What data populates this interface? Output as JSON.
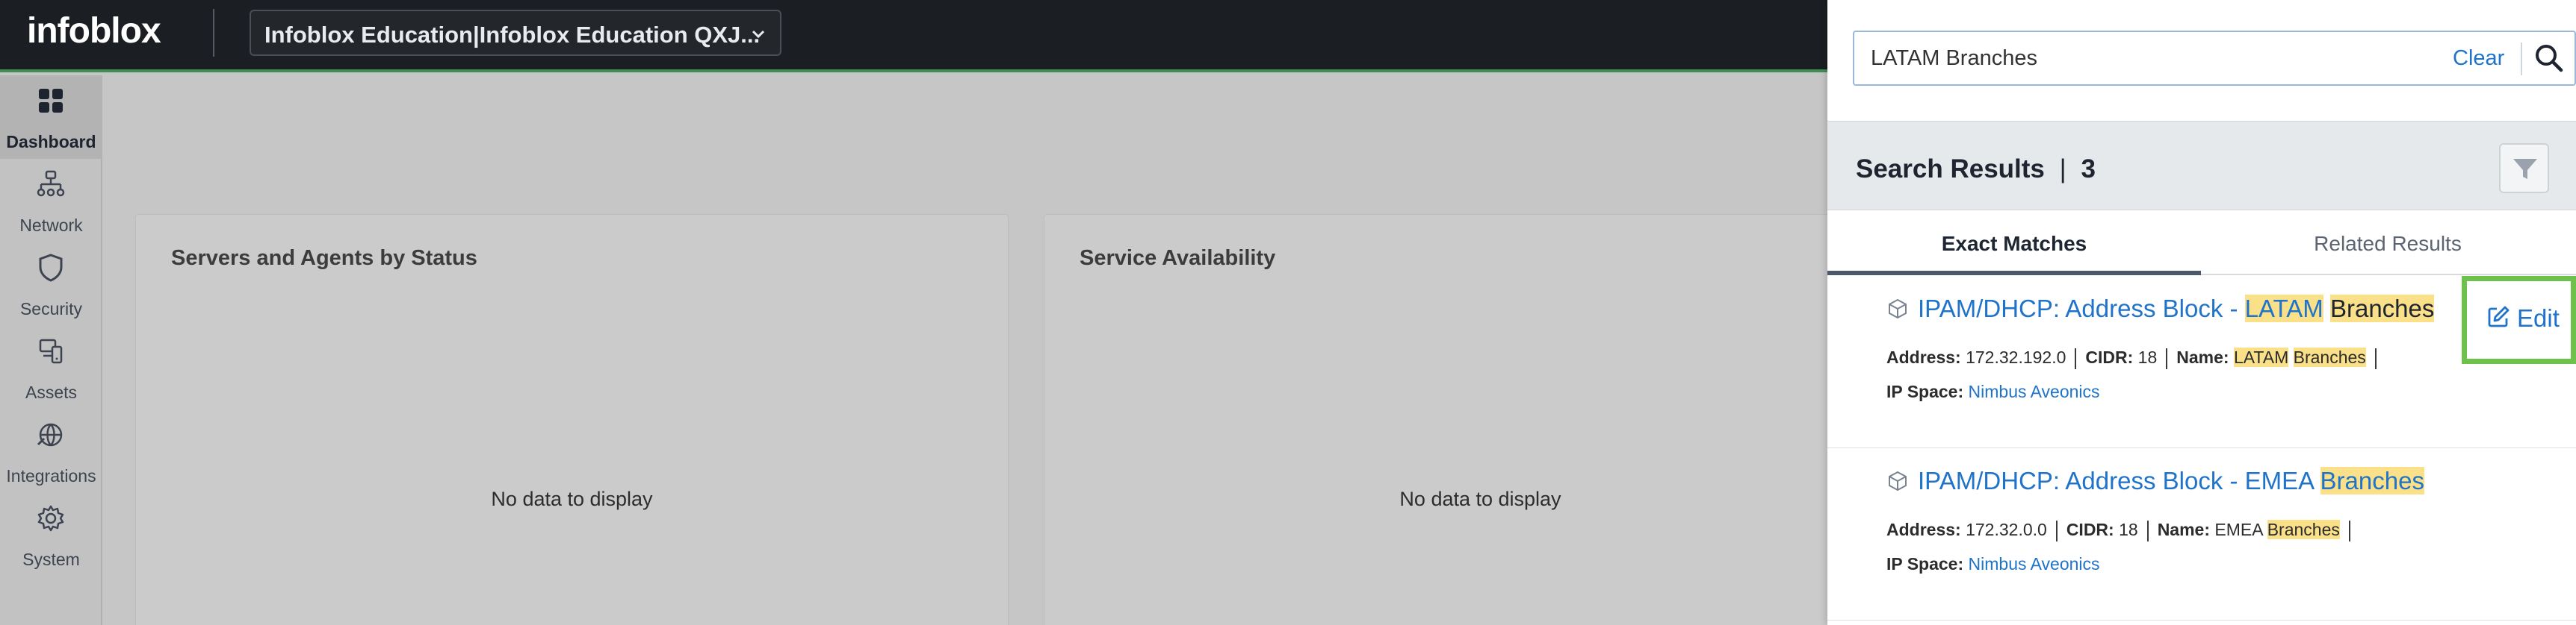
{
  "topbar": {
    "logo_text": "infoblox",
    "tenant_label": "Infoblox Education|Infoblox Education QXJ..."
  },
  "sidenav": {
    "items": [
      {
        "label": "Dashboard",
        "icon": "dashboard-icon",
        "active": true
      },
      {
        "label": "Network",
        "icon": "network-icon"
      },
      {
        "label": "Security",
        "icon": "shield-icon"
      },
      {
        "label": "Assets",
        "icon": "assets-icon"
      },
      {
        "label": "Integrations",
        "icon": "integrations-icon"
      },
      {
        "label": "System",
        "icon": "gear-icon"
      }
    ]
  },
  "cards": [
    {
      "title": "Servers and Agents by Status",
      "empty_text": "No data to display"
    },
    {
      "title": "Service Availability",
      "empty_text": "No data to display"
    }
  ],
  "search": {
    "query": "LATAM Branches",
    "clear_label": "Clear",
    "results_title": "Search Results",
    "results_count": "3",
    "tabs": [
      "Exact Matches",
      "Related Results"
    ],
    "results": [
      {
        "title_prefix": "IPAM/DHCP: Address Block - ",
        "title_hl1": "LATAM",
        "title_hl2": "Branches",
        "address_label": "Address:",
        "address": "172.32.192.0",
        "cidr_label": "CIDR:",
        "cidr": "18",
        "name_label": "Name:",
        "name_hl1": "LATAM",
        "name_hl2": "Branches",
        "ipspace_label": "IP Space:",
        "ipspace": "Nimbus Aveonics"
      },
      {
        "title_prefix": "IPAM/DHCP: Address Block - EMEA ",
        "title_hl2": "Branches",
        "address_label": "Address:",
        "address": "172.32.0.0",
        "cidr_label": "CIDR:",
        "cidr": "18",
        "name_label": "Name:",
        "name_plain": "EMEA",
        "name_hl2": "Branches",
        "ipspace_label": "IP Space:",
        "ipspace": "Nimbus Aveonics"
      }
    ],
    "edit_label": "Edit"
  },
  "colors": {
    "accent": "#1f73c9",
    "highlight": "#fbe08a",
    "focus_green": "#6cc24a",
    "topbar_bg": "#1b1e22"
  }
}
